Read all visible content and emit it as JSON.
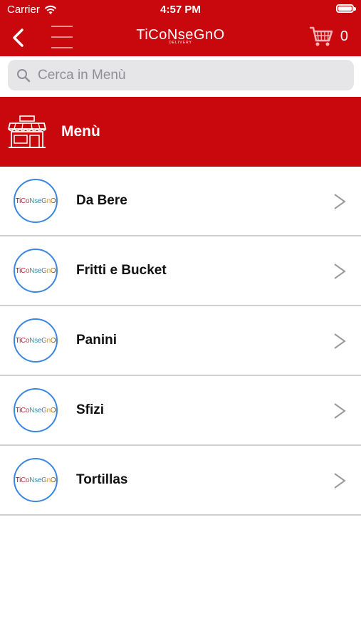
{
  "status_bar": {
    "carrier": "Carrier",
    "time": "4:57 PM"
  },
  "navbar": {
    "brand": "TiCoNseGnO",
    "brand_sub": "DELIVERY",
    "cart_count": "0"
  },
  "search": {
    "placeholder": "Cerca in Menù"
  },
  "section": {
    "title": "Menù"
  },
  "items": [
    {
      "label": "Da Bere",
      "logo_text": "TiCoNseGnO"
    },
    {
      "label": "Fritti e Bucket",
      "logo_text": "TiCoNseGnO"
    },
    {
      "label": "Panini",
      "logo_text": "TiCoNseGnO"
    },
    {
      "label": "Sfizi",
      "logo_text": "TiCoNseGnO"
    },
    {
      "label": "Tortillas",
      "logo_text": "TiCoNseGnO"
    }
  ],
  "colors": {
    "primary_red": "#c8080d",
    "logo_ring": "#3a86e0"
  }
}
